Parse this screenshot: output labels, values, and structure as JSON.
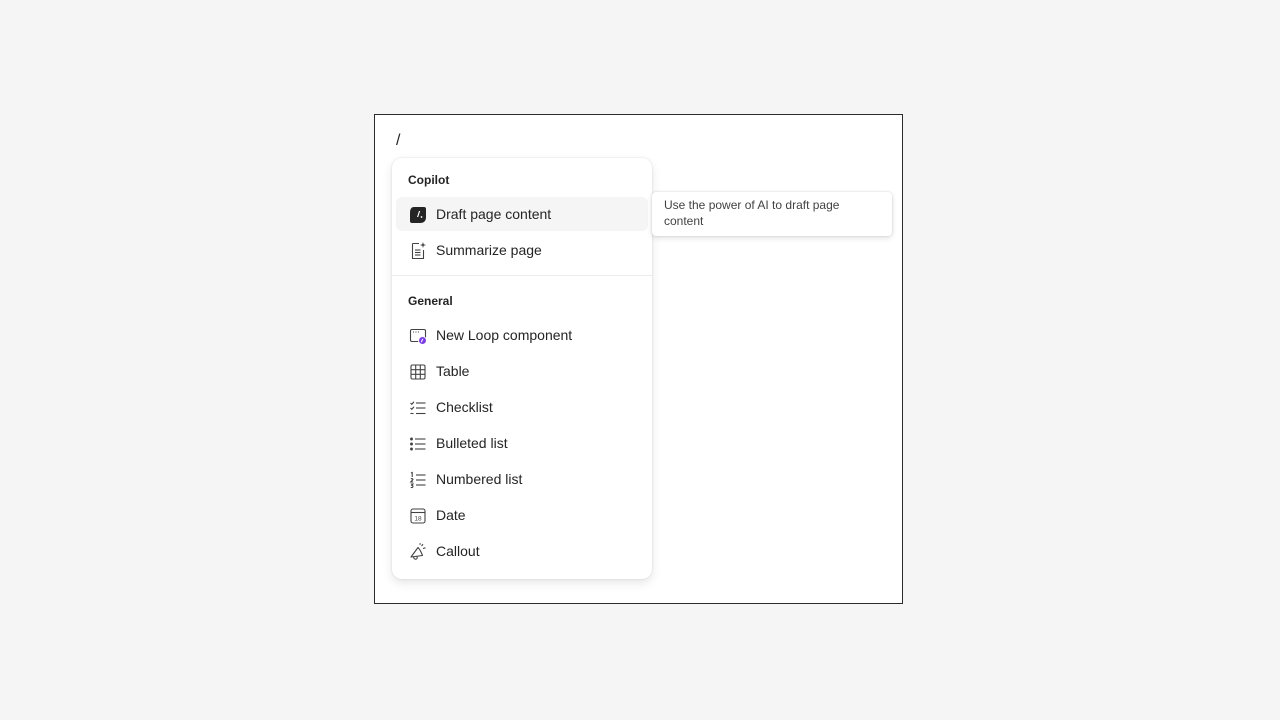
{
  "editor": {
    "slash_text": "/"
  },
  "menu": {
    "sections": [
      {
        "title": "Copilot",
        "items": [
          {
            "label": "Draft page content",
            "icon": "copilot-draft-icon"
          },
          {
            "label": "Summarize page",
            "icon": "summarize-page-icon"
          }
        ]
      },
      {
        "title": "General",
        "items": [
          {
            "label": "New Loop component",
            "icon": "loop-component-icon"
          },
          {
            "label": "Table",
            "icon": "table-icon"
          },
          {
            "label": "Checklist",
            "icon": "checklist-icon"
          },
          {
            "label": "Bulleted list",
            "icon": "bulleted-list-icon"
          },
          {
            "label": "Numbered list",
            "icon": "numbered-list-icon"
          },
          {
            "label": "Date",
            "icon": "calendar-date-icon"
          },
          {
            "label": "Callout",
            "icon": "callout-megaphone-icon"
          }
        ]
      }
    ],
    "highlighted_item": "Draft page content"
  },
  "tooltip": {
    "text": "Use the power of AI to draft page content"
  },
  "colors": {
    "page_background": "#f5f5f5",
    "canvas_background": "#ffffff",
    "highlight": "#f5f5f5",
    "loop_accent": "#7b3fe4",
    "text": "#242424"
  },
  "icons": {
    "date_number": "18"
  }
}
